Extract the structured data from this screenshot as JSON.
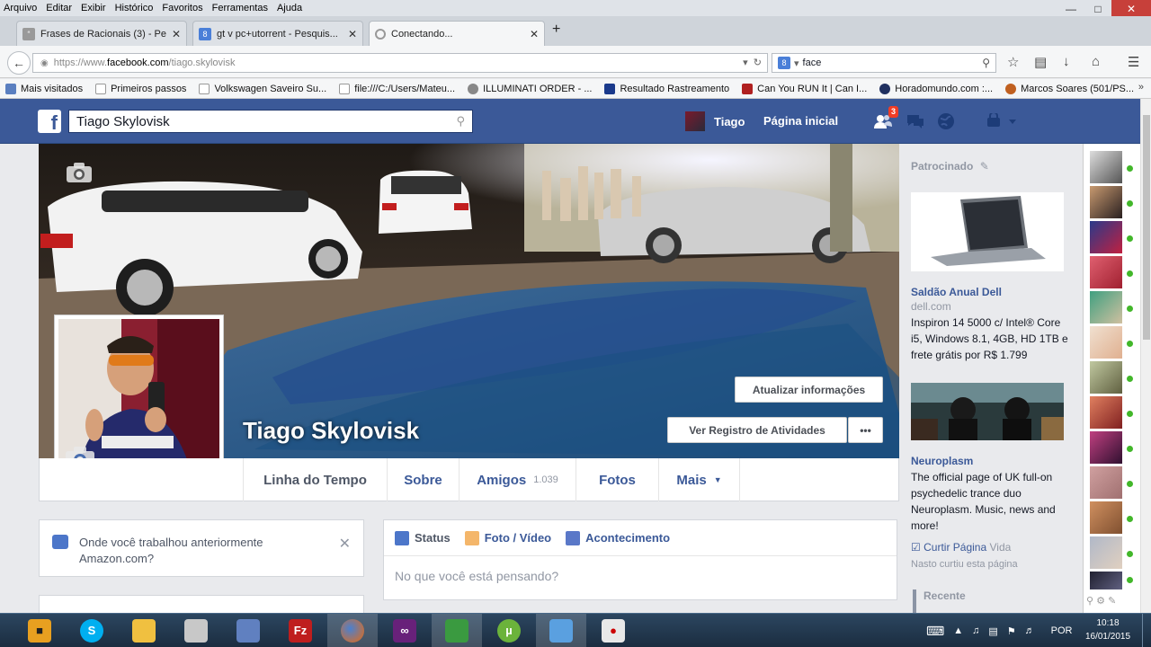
{
  "browser": {
    "menu": [
      "Arquivo",
      "Editar",
      "Exibir",
      "Histórico",
      "Favoritos",
      "Ferramentas",
      "Ajuda"
    ],
    "tabs": [
      {
        "title": "Frases de Racionais (3) - Pe...",
        "close": "✕"
      },
      {
        "title": "gt v pc+utorrent - Pesquis...",
        "close": "✕"
      },
      {
        "title": "Conectando...",
        "close": "✕"
      }
    ],
    "new_tab": "+",
    "url_prefix": "https://www.",
    "url_domain": "facebook.com",
    "url_path": "/tiago.skylovisk",
    "search_value": "face",
    "search_engine_glyph": "8",
    "bookmarks": [
      {
        "label": "Mais visitados",
        "color": "#5a7fc0"
      },
      {
        "label": "Primeiros passos",
        "color": "#ffffff"
      },
      {
        "label": "Volkswagen Saveiro Su...",
        "color": "#ffffff"
      },
      {
        "label": "file:///C:/Users/Mateu...",
        "color": "#ffffff"
      },
      {
        "label": "ILLUMINATI ORDER - ...",
        "color": "#888888"
      },
      {
        "label": "Resultado Rastreamento",
        "color": "#1b3a8c"
      },
      {
        "label": "Can You RUN It | Can I...",
        "color": "#b02020"
      },
      {
        "label": "Horadomundo.com :...",
        "color": "#203060"
      },
      {
        "label": "Marcos Soares (501/PS...",
        "color": "#c06020"
      }
    ]
  },
  "facebook": {
    "search_value": "Tiago Skylovisk",
    "user_short": "Tiago",
    "home_label": "Página inicial",
    "friend_requests_badge": "3",
    "profile_name": "Tiago Skylovisk",
    "update_info_btn": "Atualizar informações",
    "activity_log_btn": "Ver Registro de Atividades",
    "more_btn": "•••",
    "timeline_nav": {
      "timeline": "Linha do Tempo",
      "about": "Sobre",
      "friends": "Amigos",
      "friends_count": "1.039",
      "photos": "Fotos",
      "more": "Mais",
      "more_caret": "▼"
    },
    "work_prompt": "Onde você trabalhou anteriormente Amazon.com?",
    "work_close": "✕",
    "composer": {
      "status": "Status",
      "photo_video": "Foto / Vídeo",
      "event": "Acontecimento",
      "placeholder": "No que você está pensando?"
    },
    "sponsored": {
      "heading": "Patrocinado",
      "ad1": {
        "title": "Saldão Anual Dell",
        "domain": "dell.com",
        "desc": "Inspiron 14 5000 c/ Intel® Core i5, Windows 8.1, 4GB, HD 1TB e frete grátis por R$ 1.799"
      },
      "ad2": {
        "title": "Neuroplasm",
        "desc": "The official page of UK full-on psychedelic trance duo Neuroplasm. Music, news and more!",
        "like": "Curtir Página",
        "like_count": "Vida",
        "social": "Nasto curtiu esta página"
      },
      "recent": "Recente"
    }
  },
  "taskbar": {
    "tray_lang": "POR",
    "clock_time": "10:18",
    "clock_date": "16/01/2015"
  }
}
